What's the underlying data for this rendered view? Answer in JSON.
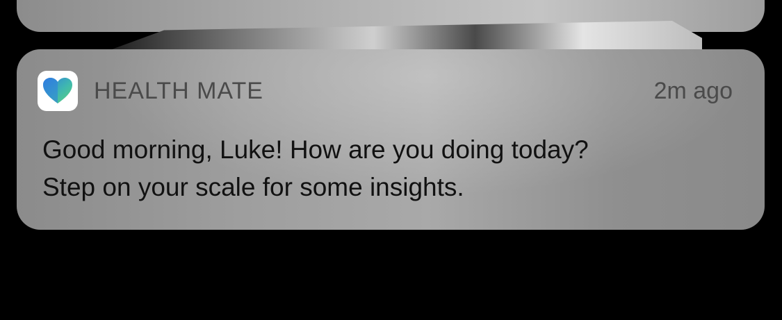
{
  "notification": {
    "app_name": "HEALTH MATE",
    "app_icon": "heart-icon",
    "timestamp": "2m ago",
    "message_lines": [
      "Good morning, Luke! How are you doing today?",
      "Step on your scale for some insights."
    ]
  },
  "colors": {
    "background": "#000000",
    "card": "#9e9e9e",
    "heart_blue": "#2f7de0",
    "heart_green": "#4fd48a"
  }
}
